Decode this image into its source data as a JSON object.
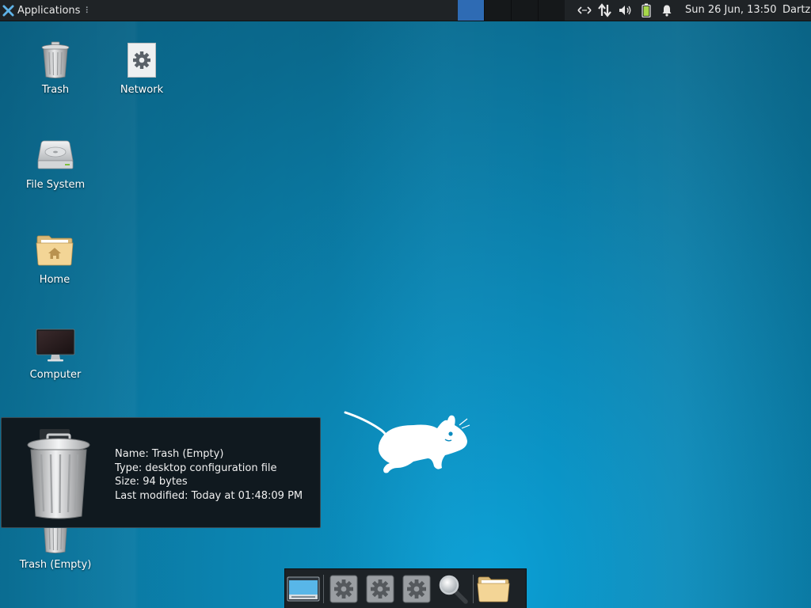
{
  "panel": {
    "applications_label": "Applications",
    "handle_glyph": "⠇",
    "workspaces": [
      {
        "name": "workspace-1",
        "active": true
      },
      {
        "name": "workspace-2",
        "active": false
      },
      {
        "name": "workspace-3",
        "active": false
      },
      {
        "name": "workspace-4",
        "active": false
      }
    ],
    "tray_icons": [
      "network-arrows-icon",
      "network-updown-icon",
      "volume-icon",
      "battery-icon",
      "notification-bell-icon"
    ],
    "clock": "Sun 26 Jun, 13:50",
    "user": "Dartz"
  },
  "desktop": {
    "icons": [
      {
        "name": "trash",
        "label": "Trash",
        "icon": "trash-icon"
      },
      {
        "name": "network",
        "label": "Network",
        "icon": "gear-icon"
      },
      {
        "name": "file-system",
        "label": "File System",
        "icon": "hard-drive-icon"
      },
      {
        "name": "home",
        "label": "Home",
        "icon": "home-folder-icon"
      },
      {
        "name": "computer",
        "label": "Computer",
        "icon": "monitor-icon"
      },
      {
        "name": "trash-empty",
        "label": "Trash (Empty)",
        "icon": "trash-icon"
      }
    ]
  },
  "tooltip": {
    "name_line": "Name: Trash (Empty)",
    "type_line": "Type: desktop configuration file",
    "size_line": "Size: 94 bytes",
    "modified_line": "Last modified: Today at 01:48:09 PM"
  },
  "dock": {
    "items": [
      "show-desktop-icon",
      "settings-gear-icon",
      "settings-gear-icon",
      "settings-gear-icon",
      "search-magnifier-icon",
      "file-manager-folder-icon"
    ]
  },
  "colors": {
    "panel_bg": "#1f2326",
    "workspace_active": "#2e6bb4",
    "desktop_bg": "#0b87b5",
    "tooltip_bg": "#10191f"
  }
}
